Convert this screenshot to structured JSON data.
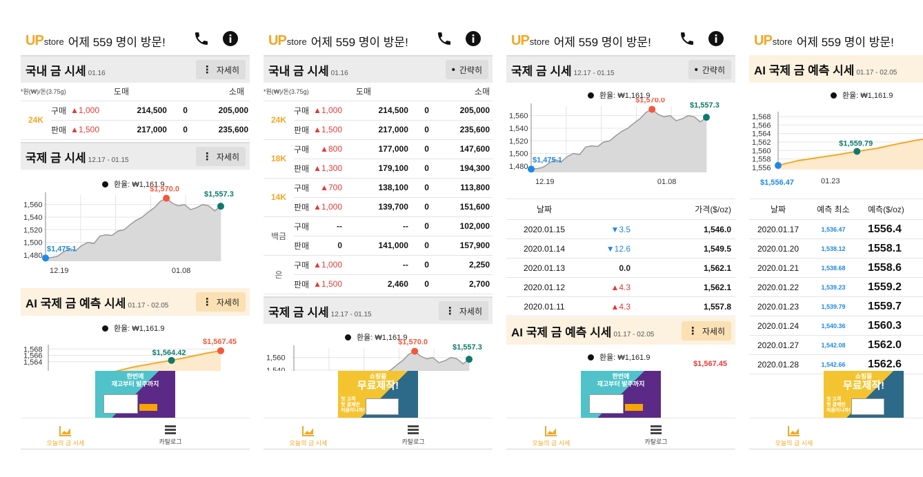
{
  "app": {
    "logo": "UP",
    "logo_sub": "store",
    "visitor_text": "어제 559 명이 방문!"
  },
  "icons": {
    "phone": "phone-icon",
    "info": "info-icon",
    "chart": "chart-icon",
    "list": "list-icon"
  },
  "colors": {
    "accent": "#f5a623",
    "up": "#e53935",
    "down": "#1e88e5",
    "teal": "#0d7a6c"
  },
  "domestic": {
    "title": "국내 금 시세",
    "date": "01.16",
    "btn_detail": "자세히",
    "btn_brief": "간략히",
    "unit": "*원(₩)/돈(3.75g)",
    "col_wholesale": "도매",
    "col_retail": "소매",
    "rows": [
      {
        "karat": "24K",
        "buy_label": "구매",
        "buy_change": "▲1,000",
        "buy_price": "214,500",
        "buy_zero": "0",
        "buy_retail": "205,000",
        "sell_label": "판매",
        "sell_change": "▲1,500",
        "sell_price": "217,000",
        "sell_zero": "0",
        "sell_retail": "235,600"
      },
      {
        "karat": "18K",
        "buy_label": "구매",
        "buy_change": "▲800",
        "buy_price": "177,000",
        "buy_zero": "0",
        "buy_retail": "147,600",
        "sell_label": "판매",
        "sell_change": "▲1,300",
        "sell_price": "179,100",
        "sell_zero": "0",
        "sell_retail": "194,300"
      },
      {
        "karat": "14K",
        "buy_label": "구매",
        "buy_change": "▲700",
        "buy_price": "138,100",
        "buy_zero": "0",
        "buy_retail": "113,800",
        "sell_label": "판매",
        "sell_change": "▲1,000",
        "sell_price": "139,700",
        "sell_zero": "0",
        "sell_retail": "151,600"
      },
      {
        "karat": "백금",
        "buy_label": "구매",
        "buy_change": "--",
        "buy_price": "--",
        "buy_zero": "0",
        "buy_retail": "102,000",
        "sell_label": "판매",
        "sell_change": "0",
        "sell_price": "141,000",
        "sell_zero": "0",
        "sell_retail": "157,900"
      },
      {
        "karat": "은",
        "buy_label": "구매",
        "buy_change": "▲1,000",
        "buy_price": "--",
        "buy_zero": "0",
        "buy_retail": "2,250",
        "sell_label": "판매",
        "sell_change": "▲1,500",
        "sell_price": "2,460",
        "sell_zero": "0",
        "sell_retail": "2,700"
      }
    ]
  },
  "international": {
    "title": "국제 금 시세",
    "date": "12.17 - 01.15",
    "btn_detail": "자세히",
    "btn_brief": "간략히",
    "fx": "환율: ₩1,161.9",
    "col_date": "날짜",
    "col_price": "가격($/oz)",
    "table": [
      {
        "date": "2020.01.15",
        "change": "▼3.5",
        "dir": "dn",
        "price": "1,546.0"
      },
      {
        "date": "2020.01.14",
        "change": "▼12.6",
        "dir": "dn",
        "price": "1,549.5"
      },
      {
        "date": "2020.01.13",
        "change": "0.0",
        "dir": "nu",
        "price": "1,562.1"
      },
      {
        "date": "2020.01.12",
        "change": "▲4.3",
        "dir": "up",
        "price": "1,562.1"
      },
      {
        "date": "2020.01.11",
        "change": "▲4.3",
        "dir": "up",
        "price": "1,557.8"
      }
    ]
  },
  "ai": {
    "title": "AI 국제 금 예측 시세",
    "date": "01.17 - 02.05",
    "btn_detail": "자세히",
    "fx": "환율: ₩1,161.9",
    "max_label": "$1,567.45",
    "mid_label": "$1,564.42",
    "col_date": "날짜",
    "col_min": "예측 최소",
    "col_pred": "예측($/oz)",
    "table": [
      {
        "date": "2020.01.17",
        "min": "1,536.47",
        "pred": "1556.4"
      },
      {
        "date": "2020.01.20",
        "min": "1,538.12",
        "pred": "1558.1"
      },
      {
        "date": "2020.01.21",
        "min": "1,538.68",
        "pred": "1558.6"
      },
      {
        "date": "2020.01.22",
        "min": "1,539.23",
        "pred": "1559.2"
      },
      {
        "date": "2020.01.23",
        "min": "1,539.79",
        "pred": "1559.7"
      },
      {
        "date": "2020.01.24",
        "min": "1,540.36",
        "pred": "1560.3"
      },
      {
        "date": "2020.01.27",
        "min": "1,542.08",
        "pred": "1562.0"
      },
      {
        "date": "2020.01.28",
        "min": "1,542.66",
        "pred": "1562.6"
      }
    ]
  },
  "ads": {
    "a1_line1": "한번에",
    "a1_line2": "재고부터 발주까지",
    "a2_line1": "쇼핑몰",
    "a2_line2": "무료제작!",
    "a2_line3": "첫 고객",
    "a2_line4": "첫 결제만",
    "a2_line5": "처음이니까!"
  },
  "nav": {
    "today": "오늘의 금 시세",
    "catalog": "카탈로그"
  },
  "chart_data": [
    {
      "type": "area",
      "title": "국제 금 시세",
      "x_ticks": [
        "12.19",
        "01.08"
      ],
      "y_ticks": [
        1480,
        1500,
        1520,
        1540,
        1560
      ],
      "ylim": [
        1470,
        1575
      ],
      "series": [
        {
          "values": [
            1475.1,
            1476,
            1478,
            1485,
            1490,
            1487,
            1495,
            1500,
            1498,
            1510,
            1512,
            1511,
            1518,
            1520,
            1528,
            1535,
            1540,
            1548,
            1555,
            1565,
            1570.0,
            1562,
            1558,
            1560,
            1552,
            1555,
            1560,
            1558,
            1550,
            1557.3
          ]
        }
      ],
      "annotations": [
        "$1,475.1",
        "$1,570.0",
        "$1,557.3"
      ]
    },
    {
      "type": "line",
      "title": "AI 국제 금 예측 시세",
      "y_ticks": [
        1556,
        1558,
        1560,
        1562,
        1564,
        1566,
        1568
      ],
      "ylim": [
        1555.5,
        1568.5
      ],
      "x_ticks": [
        "01.23"
      ],
      "series": [
        {
          "values": [
            1556.47,
            1557.6,
            1558.3,
            1559.0,
            1559.79,
            1560.5,
            1561.5,
            1562.4,
            1563.1,
            1563.8,
            1564.42,
            1565.2,
            1566.0,
            1566.8,
            1567.45
          ]
        }
      ],
      "annotations": [
        "$1,556.47",
        "$1,559.79",
        "$1,564.42",
        "$1,567.45"
      ]
    }
  ]
}
